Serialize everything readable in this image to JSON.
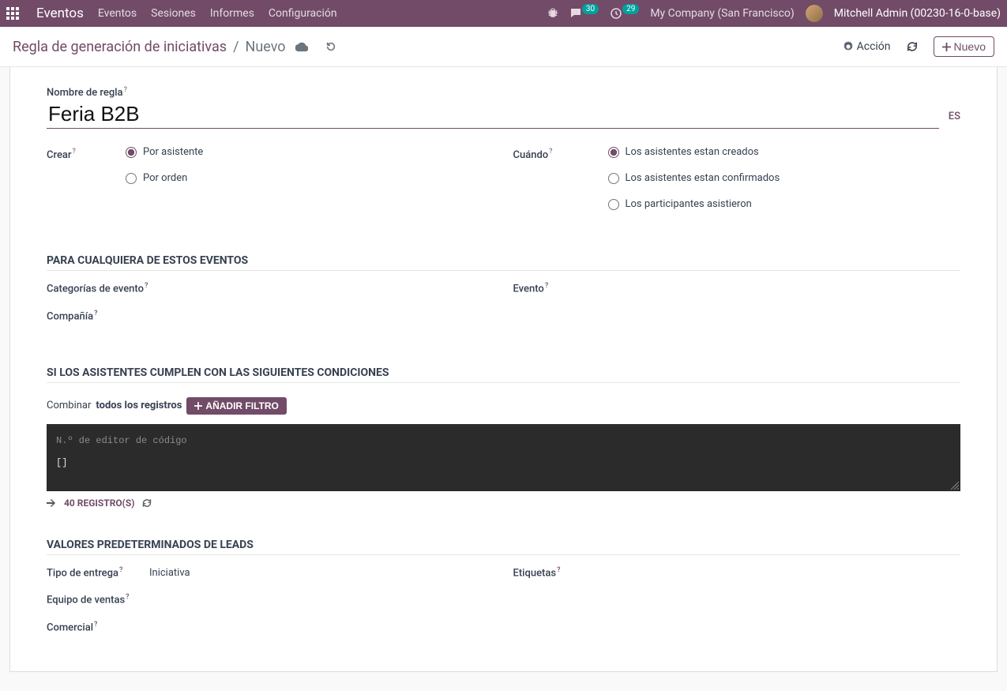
{
  "navbar": {
    "brand": "Eventos",
    "links": [
      "Eventos",
      "Sesiones",
      "Informes",
      "Configuración"
    ],
    "chat_count": "30",
    "clock_count": "29",
    "company": "My Company (San Francisco)",
    "user": "Mitchell Admin (00230-16-0-base)"
  },
  "actionbar": {
    "breadcrumb_root": "Regla de generación de iniciativas",
    "breadcrumb_current": "Nuevo",
    "action_label": "Acción",
    "new_label": "Nuevo"
  },
  "form": {
    "name_label": "Nombre de regla",
    "name_value": "Feria B2B",
    "lang_badge": "ES",
    "create_label": "Crear",
    "create_options": [
      {
        "label": "Por asistente",
        "checked": true
      },
      {
        "label": "Por orden",
        "checked": false
      }
    ],
    "when_label": "Cuándo",
    "when_options": [
      {
        "label": "Los asistentes estan creados",
        "checked": true
      },
      {
        "label": "Los asistentes estan confirmados",
        "checked": false
      },
      {
        "label": "Los participantes asistieron",
        "checked": false
      }
    ],
    "section_events": "PARA CUALQUIERA DE ESTOS EVENTOS",
    "categories_label": "Categorías de evento",
    "event_label": "Evento",
    "company_label": "Compañía",
    "section_conditions": "SI LOS ASISTENTES CUMPLEN CON LAS SIGUIENTES CONDICIONES",
    "combine_prefix": "Combinar ",
    "combine_bold": "todos los registros",
    "add_filter_label": "AÑADIR FILTRO",
    "code_placeholder": "N.º de editor de código",
    "code_content": "[]",
    "records_count": "40 REGISTRO(S)",
    "section_leads": "VALORES PREDETERMINADOS DE LEADS",
    "lead_type_label": "Tipo de entrega",
    "lead_type_value": "Iniciativa",
    "tags_label": "Etiquetas",
    "sales_team_label": "Equipo de ventas",
    "comercial_label": "Comercial"
  }
}
